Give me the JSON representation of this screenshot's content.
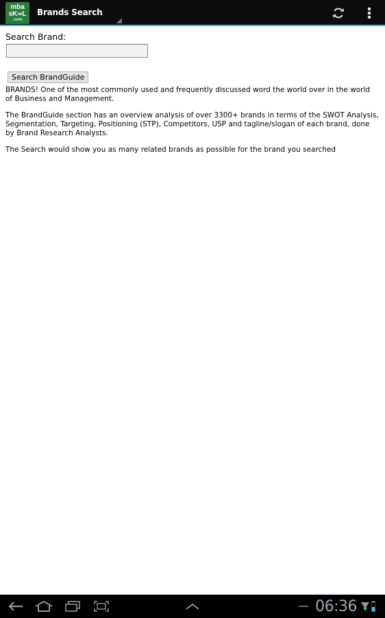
{
  "actionbar": {
    "logo_line1": "mba",
    "logo_line2": "sK∞L",
    "logo_line3": ".com",
    "title": "Brands Search",
    "refresh_icon": "refresh-icon",
    "overflow_icon": "overflow-menu-icon"
  },
  "search": {
    "label": "Search Brand:",
    "input_value": "",
    "input_placeholder": "",
    "button_label": "Search BrandGuide"
  },
  "content": {
    "para1": "BRANDS! One of the most commonly used and frequently discussed word the world over in the world of Business and Management.",
    "para2": "The BrandGuide section has an overview analysis of over 3300+ brands in terms of the SWOT Analysis, Segmentation, Targeting, Positioning (STP), Competitors, USP and tagline/slogan of each brand, done by Brand Research Analysts.",
    "para3": "The Search would show you as many related brands as possible for the brand you searched"
  },
  "statusbar": {
    "time": "06:36"
  },
  "colors": {
    "actionbar_bg": "#0c0c0c",
    "actionbar_accent": "#33b5e5",
    "logo_green": "#2a7d3c",
    "navbar_bg": "#000000",
    "clock": "#a0aab0"
  }
}
